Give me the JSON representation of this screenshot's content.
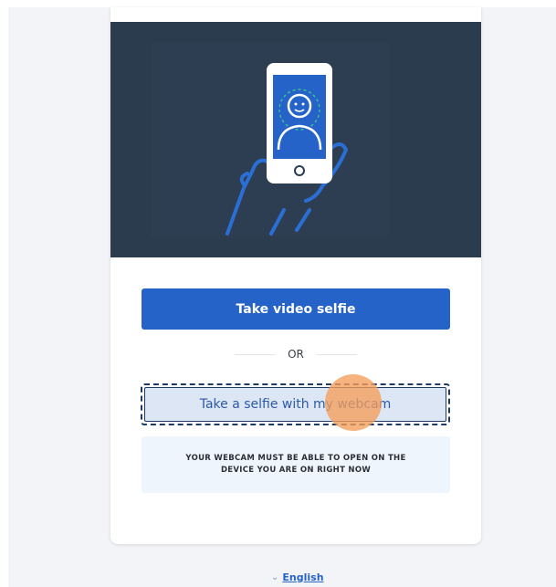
{
  "actions": {
    "primary_label": "Take video selfie",
    "divider_label": "OR",
    "webcam_label": "Take a selfie with my webcam"
  },
  "notice": {
    "text": "YOUR WEBCAM MUST BE ABLE TO OPEN ON THE DEVICE YOU ARE ON RIGHT NOW"
  },
  "footer": {
    "language_label": "English",
    "language_icon": "chevron-down-icon"
  },
  "colors": {
    "accent": "#2563c9",
    "hero_bg": "#2c3c4f",
    "click_indicator": "#f59e5a"
  },
  "illustration": {
    "icon": "phone-selfie-illustration"
  }
}
